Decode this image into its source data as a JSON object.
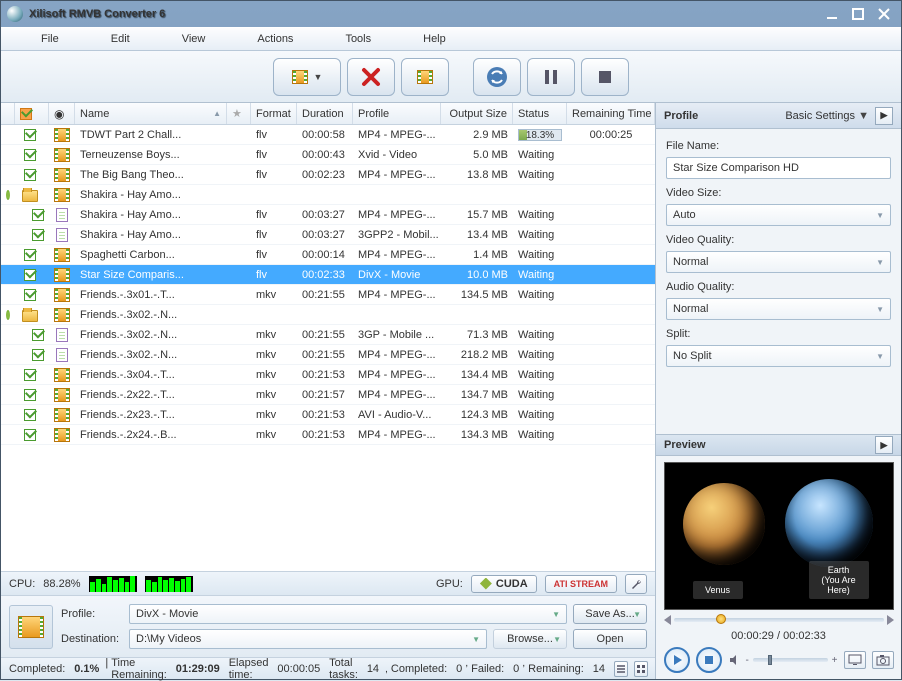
{
  "title": "Xilisoft RMVB Converter 6",
  "menu": [
    "File",
    "Edit",
    "View",
    "Actions",
    "Tools",
    "Help"
  ],
  "columns": {
    "name": "Name",
    "format": "Format",
    "duration": "Duration",
    "profile": "Profile",
    "output": "Output Size",
    "status": "Status",
    "remaining": "Remaining Time"
  },
  "rows": [
    {
      "indent": 0,
      "chk": true,
      "type": "film",
      "name": "TDWT Part 2 Chall...",
      "fmt": "flv",
      "dur": "00:00:58",
      "prof": "MP4 - MPEG-...",
      "out": "2.9 MB",
      "stat": "progress",
      "pct": 18.3,
      "rem": "00:00:25"
    },
    {
      "indent": 0,
      "chk": true,
      "type": "film",
      "name": "Terneuzense Boys...",
      "fmt": "flv",
      "dur": "00:00:43",
      "prof": "Xvid - Video",
      "out": "5.0 MB",
      "stat": "Waiting",
      "rem": ""
    },
    {
      "indent": 0,
      "chk": true,
      "type": "film",
      "name": "The Big Bang Theo...",
      "fmt": "flv",
      "dur": "00:02:23",
      "prof": "MP4 - MPEG-...",
      "out": "13.8 MB",
      "stat": "Waiting",
      "rem": ""
    },
    {
      "indent": 0,
      "group": true,
      "exp": "minus",
      "type": "folder",
      "name": "Shakira - Hay Amo...",
      "fmt": "",
      "dur": "",
      "prof": "",
      "out": "",
      "stat": "",
      "rem": ""
    },
    {
      "indent": 1,
      "chk": true,
      "type": "doc",
      "name": "Shakira - Hay Amo...",
      "fmt": "flv",
      "dur": "00:03:27",
      "prof": "MP4 - MPEG-...",
      "out": "15.7 MB",
      "stat": "Waiting",
      "rem": ""
    },
    {
      "indent": 1,
      "chk": true,
      "type": "doc",
      "name": "Shakira - Hay Amo...",
      "fmt": "flv",
      "dur": "00:03:27",
      "prof": "3GPP2 - Mobil...",
      "out": "13.4 MB",
      "stat": "Waiting",
      "rem": ""
    },
    {
      "indent": 0,
      "chk": true,
      "type": "film",
      "name": "Spaghetti Carbon...",
      "fmt": "flv",
      "dur": "00:00:14",
      "prof": "MP4 - MPEG-...",
      "out": "1.4 MB",
      "stat": "Waiting",
      "rem": ""
    },
    {
      "indent": 0,
      "chk": true,
      "type": "film",
      "name": "Star Size Comparis...",
      "fmt": "flv",
      "dur": "00:02:33",
      "prof": "DivX - Movie",
      "out": "10.0 MB",
      "stat": "Waiting",
      "rem": "",
      "sel": true
    },
    {
      "indent": 0,
      "chk": true,
      "type": "film",
      "name": "Friends.-.3x01.-.T...",
      "fmt": "mkv",
      "dur": "00:21:55",
      "prof": "MP4 - MPEG-...",
      "out": "134.5 MB",
      "stat": "Waiting",
      "rem": ""
    },
    {
      "indent": 0,
      "group": true,
      "exp": "minus",
      "type": "folder",
      "name": "Friends.-.3x02.-.N...",
      "fmt": "",
      "dur": "",
      "prof": "",
      "out": "",
      "stat": "",
      "rem": ""
    },
    {
      "indent": 1,
      "chk": true,
      "type": "doc",
      "name": "Friends.-.3x02.-.N...",
      "fmt": "mkv",
      "dur": "00:21:55",
      "prof": "3GP - Mobile ...",
      "out": "71.3 MB",
      "stat": "Waiting",
      "rem": ""
    },
    {
      "indent": 1,
      "chk": true,
      "type": "doc",
      "name": "Friends.-.3x02.-.N...",
      "fmt": "mkv",
      "dur": "00:21:55",
      "prof": "MP4 - MPEG-...",
      "out": "218.2 MB",
      "stat": "Waiting",
      "rem": ""
    },
    {
      "indent": 0,
      "chk": true,
      "type": "film",
      "name": "Friends.-.3x04.-.T...",
      "fmt": "mkv",
      "dur": "00:21:53",
      "prof": "MP4 - MPEG-...",
      "out": "134.4 MB",
      "stat": "Waiting",
      "rem": ""
    },
    {
      "indent": 0,
      "chk": true,
      "type": "film",
      "name": "Friends.-.2x22.-.T...",
      "fmt": "mkv",
      "dur": "00:21:57",
      "prof": "MP4 - MPEG-...",
      "out": "134.7 MB",
      "stat": "Waiting",
      "rem": ""
    },
    {
      "indent": 0,
      "chk": true,
      "type": "film",
      "name": "Friends.-.2x23.-.T...",
      "fmt": "mkv",
      "dur": "00:21:53",
      "prof": "AVI - Audio-V...",
      "out": "124.3 MB",
      "stat": "Waiting",
      "rem": ""
    },
    {
      "indent": 0,
      "chk": true,
      "type": "film",
      "name": "Friends.-.2x24.-.B...",
      "fmt": "mkv",
      "dur": "00:21:53",
      "prof": "MP4 - MPEG-...",
      "out": "134.3 MB",
      "stat": "Waiting",
      "rem": ""
    }
  ],
  "cpu": {
    "label": "CPU:",
    "value": "88.28%"
  },
  "gpu": {
    "label": "GPU:",
    "cuda": "CUDA",
    "ati": "ATI STREAM"
  },
  "bottom": {
    "profileLabel": "Profile:",
    "profileValue": "DivX - Movie",
    "destLabel": "Destination:",
    "destValue": "D:\\My Videos",
    "saveAs": "Save As...",
    "browse": "Browse...",
    "open": "Open"
  },
  "status": {
    "completedLabel": "Completed:",
    "completedVal": "0.1%",
    "timeRemLabel": "Time Remaining:",
    "timeRemVal": "01:29:09",
    "elapsedLabel": "Elapsed time:",
    "elapsedVal": "00:00:05",
    "totalLabel": "Total tasks:",
    "totalVal": "14",
    "compLabel": "Completed:",
    "compVal": "0",
    "failLabel": "Failed:",
    "failVal": "0",
    "remLabel": "Remaining:",
    "remVal": "14"
  },
  "profile": {
    "head": "Profile",
    "settings": "Basic Settings",
    "fileNameLabel": "File Name:",
    "fileName": "Star Size Comparison HD",
    "videoSizeLabel": "Video Size:",
    "videoSize": "Auto",
    "videoQualityLabel": "Video Quality:",
    "videoQuality": "Normal",
    "audioQualityLabel": "Audio Quality:",
    "audioQuality": "Normal",
    "splitLabel": "Split:",
    "split": "No Split"
  },
  "preview": {
    "head": "Preview",
    "time": "00:00:29 / 00:02:33",
    "label1": "Venus",
    "label2": "Earth\n(You Are Here)",
    "pos": 20
  }
}
